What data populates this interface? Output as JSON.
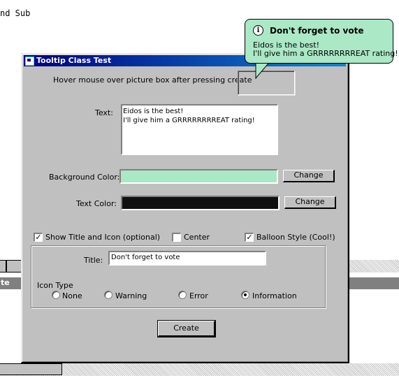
{
  "background": {
    "code_text": "nd Sub",
    "gray_bar_text": "te"
  },
  "window": {
    "title": "Tooltip Class Test"
  },
  "form": {
    "hover_label": "Hover mouse over picture box after pressing create",
    "text_label": "Text:",
    "text_value_line1": "Eidos is the best!",
    "text_value_line2": "I'll give him a GRRRRRRRREAT rating!",
    "bg_color_label": "Background Color:",
    "bg_color_value": "#aae8c6",
    "bg_change_label": "Change",
    "text_color_label": "Text Color:",
    "text_color_value": "#101010",
    "text_change_label": "Change",
    "show_title_label": "Show Title and Icon (optional)",
    "show_title_checked": true,
    "center_label": "Center",
    "center_checked": false,
    "balloon_label": "Balloon Style (Cool!)",
    "balloon_checked": true,
    "title_label": "Title:",
    "title_value": "Don't forget to vote",
    "icon_type_label": "Icon Type",
    "icon_options": [
      {
        "label": "None",
        "selected": false
      },
      {
        "label": "Warning",
        "selected": false
      },
      {
        "label": "Error",
        "selected": false
      },
      {
        "label": "Information",
        "selected": true
      }
    ],
    "create_label": "Create"
  },
  "balloon": {
    "icon": "information-icon",
    "icon_glyph": "i",
    "title": "Don't forget to vote",
    "line1": "Eidos is the best!",
    "line2": "I'll give him a GRRRRRRRREAT rating!"
  }
}
